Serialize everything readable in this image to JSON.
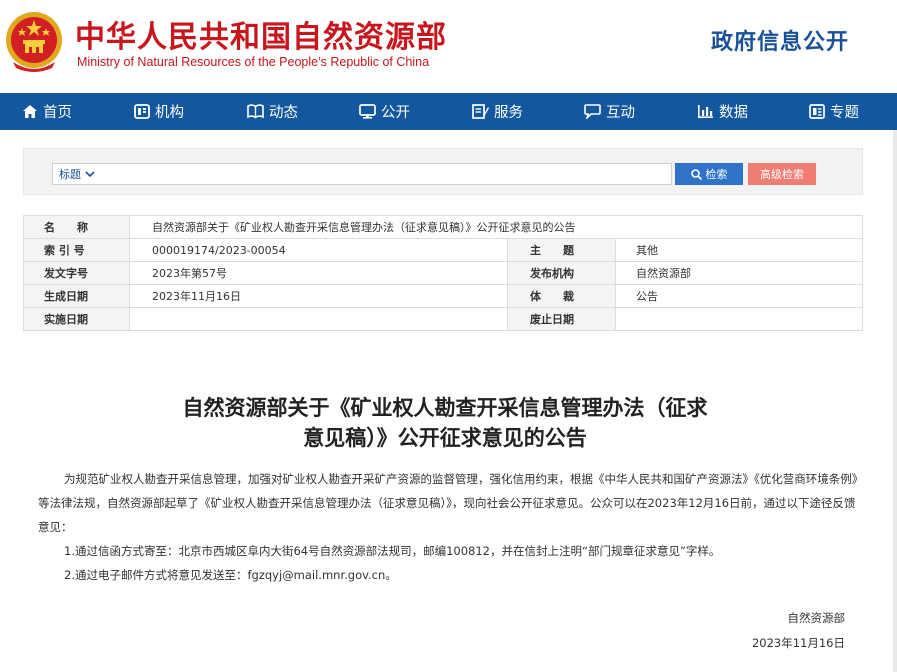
{
  "header": {
    "title_cn": "中华人民共和国自然资源部",
    "title_en": "Ministry of Natural Resources of the People’s Republic of China",
    "gov_open": "政府信息公开"
  },
  "nav": {
    "items": [
      {
        "label": "首页",
        "icon": "home-icon"
      },
      {
        "label": "机构",
        "icon": "org-icon"
      },
      {
        "label": "动态",
        "icon": "book-icon"
      },
      {
        "label": "公开",
        "icon": "monitor-icon"
      },
      {
        "label": "服务",
        "icon": "edit-icon"
      },
      {
        "label": "互动",
        "icon": "chat-icon"
      },
      {
        "label": "数据",
        "icon": "bar-chart-icon"
      },
      {
        "label": "专题",
        "icon": "document-icon"
      }
    ]
  },
  "search": {
    "type_label": "标题",
    "value": "",
    "search_label": "检索",
    "advanced_label": "高级检索"
  },
  "info": {
    "name_label": "名　　称",
    "name_value": "自然资源部关于《矿业权人勘查开采信息管理办法（征求意见稿）》公开征求意见的公告",
    "index_label": "索 引 号",
    "index_value": "000019174/2023-00054",
    "subject_label": "主　　题",
    "subject_value": "其他",
    "doc_no_label": "发文字号",
    "doc_no_value": "2023年第57号",
    "issuer_label": "发布机构",
    "issuer_value": "自然资源部",
    "date_label": "生成日期",
    "date_value": "2023年11月16日",
    "genre_label": "体　　裁",
    "genre_value": "公告",
    "effective_label": "实施日期",
    "effective_value": "",
    "abolish_label": "废止日期",
    "abolish_value": ""
  },
  "article": {
    "title_line1": "自然资源部关于《矿业权人勘查开采信息管理办法（征求",
    "title_line2": "意见稿）》公开征求意见的公告",
    "para1": "为规范矿业权人勘查开采信息管理，加强对矿业权人勘查开采矿产资源的监督管理，强化信用约束，根据《中华人民共和国矿产资源法》《优化营商环境条例》等法律法规，自然资源部起草了《矿业权人勘查开采信息管理办法（征求意见稿）》，现向社会公开征求意见。公众可以在2023年12月16日前，通过以下途径反馈意见：",
    "item1": "1.通过信函方式寄至：北京市西城区阜内大街64号自然资源部法规司，邮编100812，并在信封上注明“部门规章征求意见”字样。",
    "item2": "2.通过电子邮件方式将意见发送至：fgzqyj@mail.mnr.gov.cn。",
    "sign_org": "自然资源部",
    "sign_date": "2023年11月16日"
  },
  "colors": {
    "brand_red": "#c8161d",
    "nav_blue": "#13579f",
    "search_blue": "#2f73c9",
    "advanced_red": "#f07d73"
  }
}
